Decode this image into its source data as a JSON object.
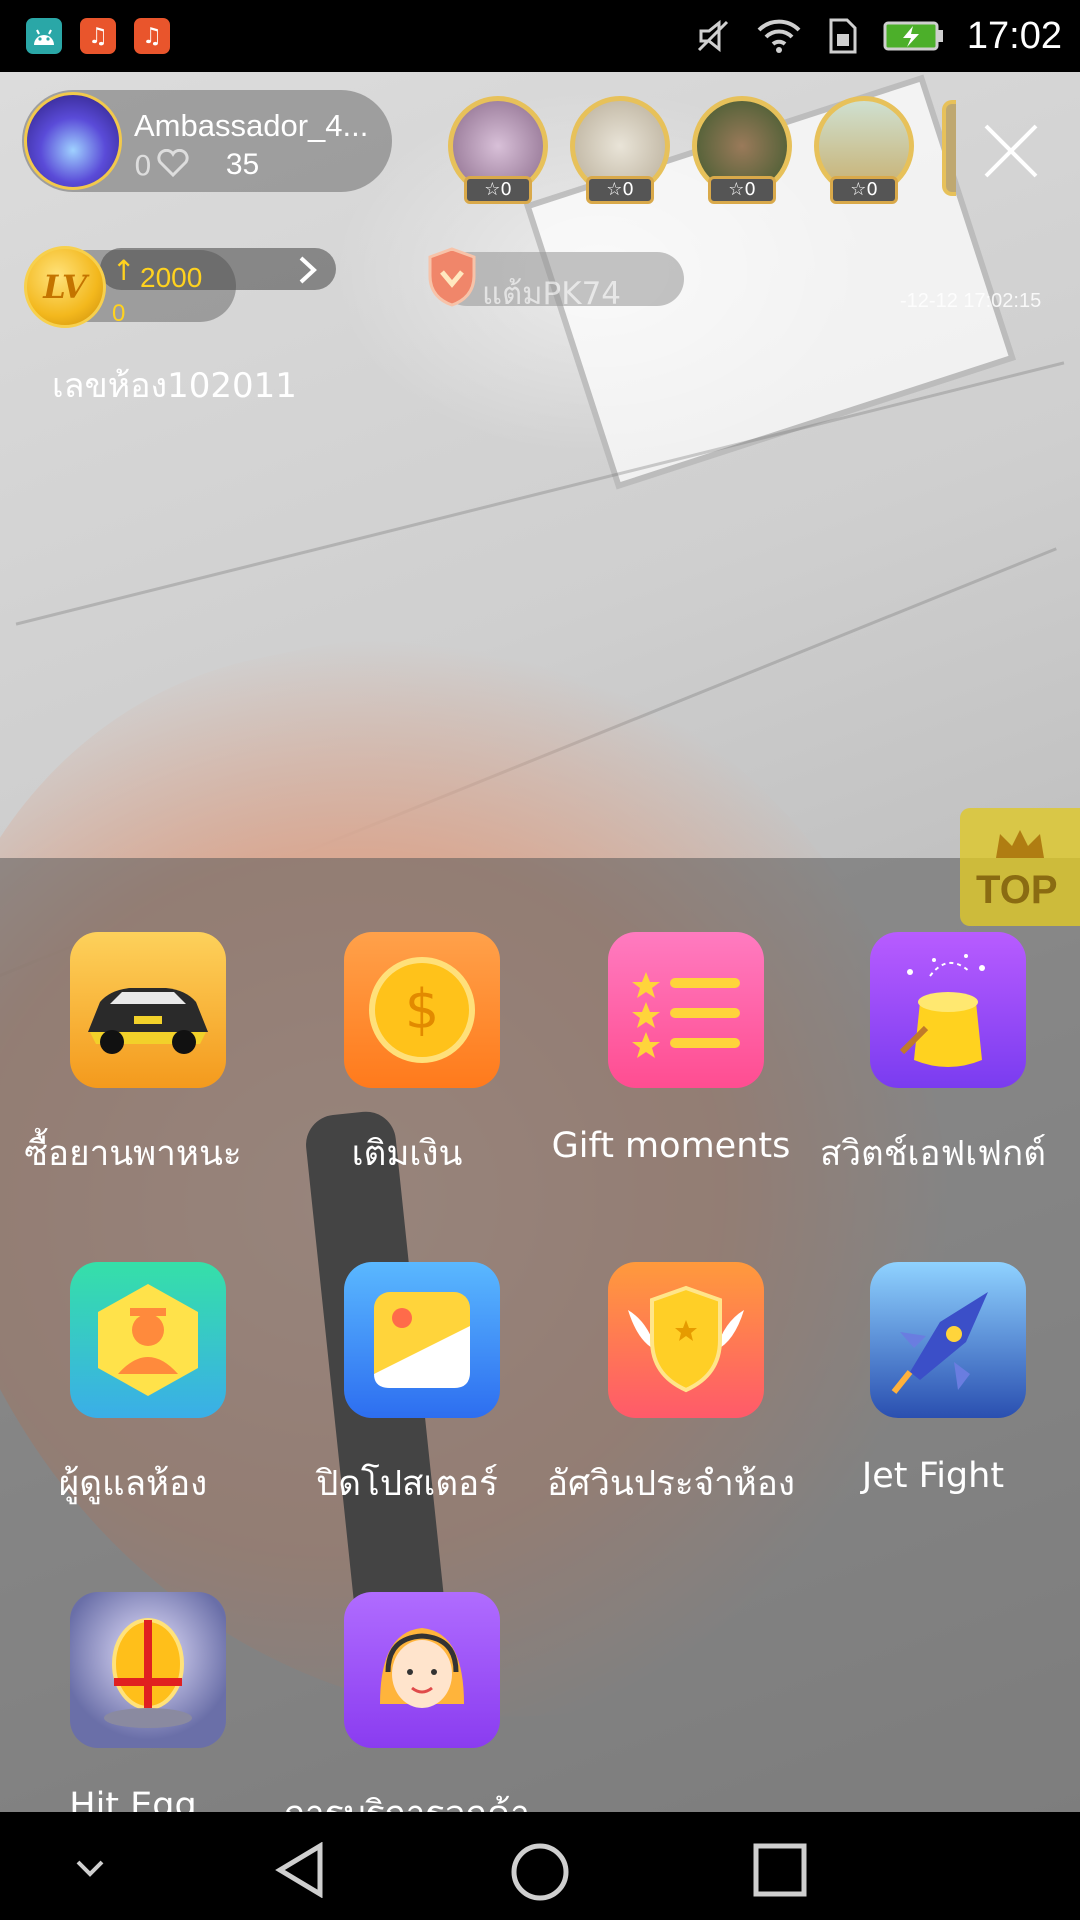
{
  "status_bar": {
    "time": "17:02",
    "notifications": [
      {
        "icon": "android-icon",
        "glyph": "🤖"
      },
      {
        "icon": "music-icon",
        "glyph": "♫"
      },
      {
        "icon": "music-icon",
        "glyph": "♫"
      }
    ],
    "system_icons": [
      "mute-icon",
      "wifi-icon",
      "sim-icon",
      "battery-charging-icon"
    ]
  },
  "host": {
    "name": "Ambassador_4...",
    "follow_zero": "0",
    "like_count": "35"
  },
  "viewers": [
    {
      "badge": "☆0"
    },
    {
      "badge": "☆0"
    },
    {
      "badge": "☆0"
    },
    {
      "badge": "☆0"
    }
  ],
  "level": {
    "badge": "LV",
    "up_arrow": "↑",
    "value": "2000",
    "progress": "0"
  },
  "pk": {
    "label": "แต้มPK74"
  },
  "stream_timestamp": "-12-12 17:02:15",
  "room": {
    "id_label": "เลขห้อง102011"
  },
  "top_badge": {
    "label": "TOP"
  },
  "features": [
    {
      "label": "ซื้อยานพาหนะ",
      "icon": "sports-car-icon",
      "bg": "#f9b234"
    },
    {
      "label": "เติมเงิน",
      "icon": "gold-coin-icon",
      "bg": "#ff8a2a"
    },
    {
      "label": "Gift moments",
      "icon": "star-list-icon",
      "bg": "#ff5fa8"
    },
    {
      "label": "สวิตช์เอฟเฟกต์",
      "icon": "magic-hat-icon",
      "bg": "#9b43f0"
    },
    {
      "label": "ผู้ดูแลห้อง",
      "icon": "room-admin-icon",
      "bg": "#3fd3b5"
    },
    {
      "label": "ปิดโปสเตอร์",
      "icon": "poster-icon",
      "bg": "#3f86ff"
    },
    {
      "label": "อัศวินประจำห้อง",
      "icon": "winged-shield-icon",
      "bg": "#ff7a52"
    },
    {
      "label": "Jet Fight",
      "icon": "jet-fighter-icon",
      "bg": "#3b6fd6"
    },
    {
      "label": "Hit Egg",
      "icon": "golden-egg-icon",
      "bg": "#5d6fa8"
    },
    {
      "label": "การบริการลูกค้า",
      "icon": "customer-service-icon",
      "bg": "#a45cf5"
    }
  ],
  "nav": [
    "collapse-icon",
    "back-icon",
    "home-icon",
    "recents-icon"
  ]
}
